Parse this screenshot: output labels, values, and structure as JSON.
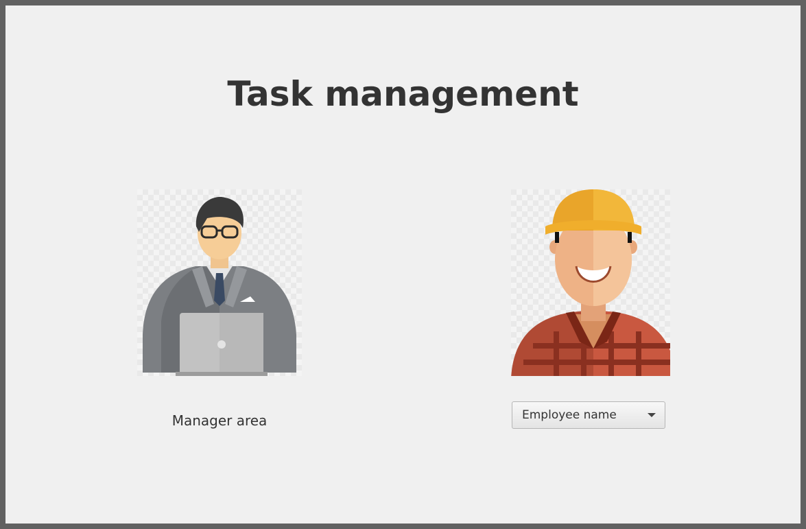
{
  "title": "Task management",
  "manager": {
    "label": "Manager area",
    "icon": "manager-avatar-icon"
  },
  "employee": {
    "icon": "employee-avatar-icon",
    "select_value": "Employee name"
  }
}
